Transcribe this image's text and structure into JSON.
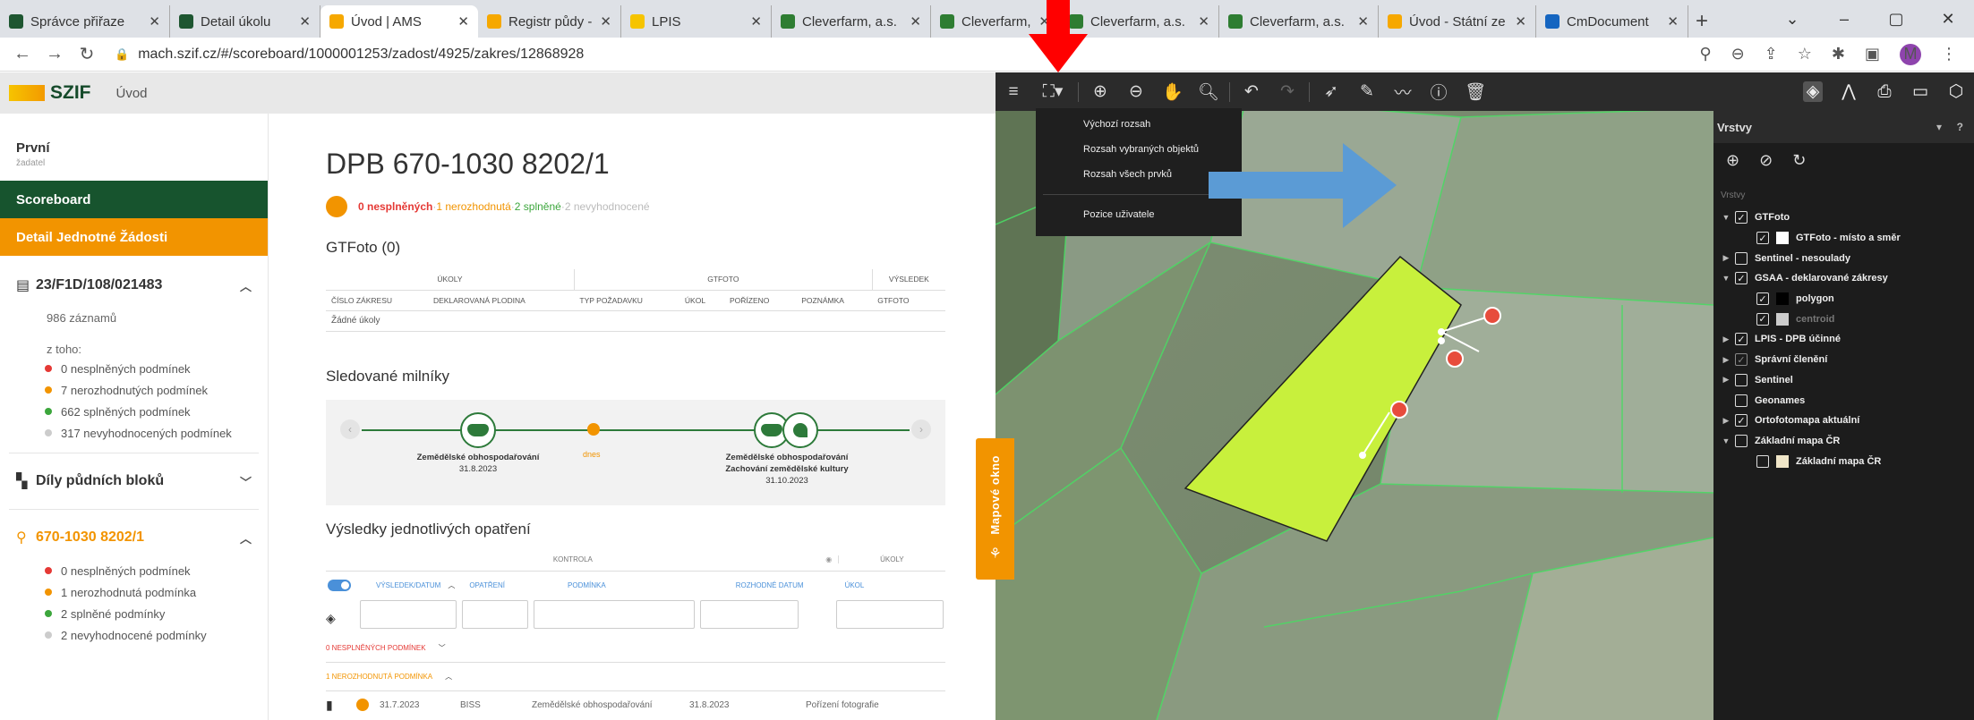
{
  "browser": {
    "tabs": [
      {
        "title": "Správce přiřaze",
        "favicon_color": "#1e5631"
      },
      {
        "title": "Detail úkolu",
        "favicon_color": "#1e5631"
      },
      {
        "title": "Úvod | AMS",
        "favicon_color": "#f6a800",
        "active": true
      },
      {
        "title": "Registr půdy - L",
        "favicon_color": "#f6a800"
      },
      {
        "title": "LPIS",
        "favicon_color": "#f6c400"
      },
      {
        "title": "Cleverfarm, a.s.",
        "favicon_color": "#2e7d32"
      },
      {
        "title": "Cleverfarm, a.s.",
        "favicon_color": "#2e7d32"
      },
      {
        "title": "Cleverfarm, a.s.",
        "favicon_color": "#2e7d32"
      },
      {
        "title": "Cleverfarm, a.s.",
        "favicon_color": "#2e7d32"
      },
      {
        "title": "Úvod - Státní ze",
        "favicon_color": "#f6a800"
      },
      {
        "title": "CmDocument",
        "favicon_color": "#1565c0"
      }
    ],
    "url": "mach.szif.cz/#/scoreboard/1000001253/zadost/4925/zakres/12868928",
    "avatar_letter": "M",
    "window": {
      "minimize": "–",
      "maximize": "▢",
      "close": "✕"
    }
  },
  "app": {
    "logo": "SZIF",
    "home": "Úvod"
  },
  "sidebar": {
    "user_name": "První",
    "user_role": "žadatel",
    "scoreboard": "Scoreboard",
    "detail": "Detail Jednotné Žádosti",
    "request": {
      "id": "23/F1D/108/021483",
      "records": "986 záznamů",
      "of_which": "z toho:",
      "stats": [
        {
          "text": "0 nesplněných podmínek",
          "color": "#e53935"
        },
        {
          "text": "7 nerozhodnutých podmínek",
          "color": "#f29400"
        },
        {
          "text": "662 splněných podmínek",
          "color": "#3ca63c"
        },
        {
          "text": "317 nevyhodnocených podmínek",
          "color": "#ccc"
        }
      ]
    },
    "blocks": "Díly půdních bloků",
    "dpb": {
      "id": "670-1030 8202/1",
      "stats": [
        {
          "text": "0 nesplněných podmínek",
          "color": "#e53935"
        },
        {
          "text": "1 nerozhodnutá podmínka",
          "color": "#f29400"
        },
        {
          "text": "2 splněné podmínky",
          "color": "#3ca63c"
        },
        {
          "text": "2 nevyhodnocené podmínky",
          "color": "#ccc"
        }
      ]
    }
  },
  "main": {
    "title": "DPB 670-1030 8202/1",
    "summary": {
      "a": "0 nesplněných",
      "b": "1 nerozhodnutá",
      "c": "2 splněné",
      "d": "2 nevyhodnocené",
      "sep": " · "
    },
    "gtfoto": {
      "heading": "GTFoto (0)",
      "groups": [
        "ÚKOLY",
        "GTFOTO",
        "VÝSLEDEK"
      ],
      "columns": [
        "ČÍSLO ZÁKRESU",
        "DEKLAROVANÁ PLODINA",
        "TYP POŽADAVKU",
        "ÚKOL",
        "POŘÍZENO",
        "POZNÁMKA",
        "GTFOTO"
      ],
      "empty": "Žádné úkoly"
    },
    "milestones": {
      "heading": "Sledované milníky",
      "today": "dnes",
      "left": {
        "label": "Zemědělské obhospodařování",
        "date": "31.8.2023"
      },
      "right": {
        "label1": "Zemědělské obhospodařování",
        "label2": "Zachování zemědělské kultury",
        "date": "31.10.2023"
      }
    },
    "results": {
      "heading": "Výsledky jednotlivých opatření",
      "groups": [
        "KONTROLA",
        "ÚKOLY"
      ],
      "columns": [
        "VÝSLEDEK/DATUM",
        "OPATŘENÍ",
        "PODMÍNKA",
        "ROZHODNÉ DATUM",
        "ÚKOL"
      ],
      "group_unfulfilled": "0 NESPLNĚNÝCH PODMÍNEK",
      "group_undecided": "1 NEROZHODNUTÁ PODMÍNKA",
      "row": {
        "date": "31.7.2023",
        "measure": "BISS",
        "condition": "Zemědělské obhospodařování",
        "decisive_date": "31.8.2023",
        "task": "Pořízení fotografie"
      }
    }
  },
  "map": {
    "handle_label": "Mapové okno",
    "dropdown": [
      "Výchozí rozsah",
      "Rozsah vybraných objektů",
      "Rozsah všech prvků",
      "Pozice uživatele"
    ],
    "layers": {
      "title": "Vrstvy",
      "sub": "Vrstvy",
      "items": [
        {
          "label": "GTFoto",
          "caret": "▼",
          "checked": true,
          "indent": 0
        },
        {
          "label": "GTFoto - místo a směr",
          "checked": true,
          "indent": 1,
          "swatch": "#ffffff"
        },
        {
          "label": "Sentinel - nesoulady",
          "caret": "▶",
          "checked": false,
          "indent": 0
        },
        {
          "label": "GSAA - deklarované zákresy",
          "caret": "▼",
          "checked": true,
          "indent": 0
        },
        {
          "label": "polygon",
          "checked": true,
          "indent": 1,
          "swatch": "#000000"
        },
        {
          "label": "centroid",
          "checked": true,
          "indent": 1,
          "swatch": "#cccccc",
          "dim": true
        },
        {
          "label": "LPIS - DPB účinné",
          "caret": "▶",
          "checked": true,
          "indent": 0
        },
        {
          "label": "Správní členění",
          "caret": "▶",
          "checked": true,
          "indent": 0,
          "dimcb": true
        },
        {
          "label": "Sentinel",
          "caret": "▶",
          "checked": false,
          "indent": 0
        },
        {
          "label": "Geonames",
          "checked": false,
          "indent": 0
        },
        {
          "label": "Ortofotomapa aktuální",
          "caret": "▶",
          "checked": true,
          "indent": 0
        },
        {
          "label": "Základní mapa ČR",
          "caret": "▼",
          "checked": false,
          "indent": 0
        },
        {
          "label": "Základní mapa ČR",
          "checked": false,
          "indent": 1,
          "swatch": "#f0e6c8"
        }
      ]
    }
  },
  "colors": {
    "szif_green": "#17542e",
    "szif_orange": "#f29400",
    "field": "#c8f03c",
    "annot_red": "#ff0000",
    "annot_blue": "#5b9bd5"
  }
}
